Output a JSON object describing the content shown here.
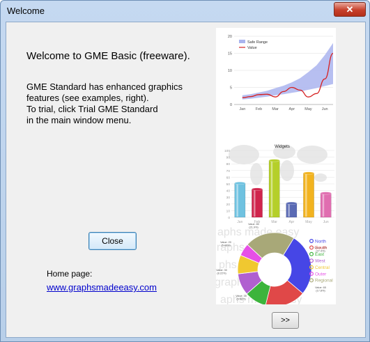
{
  "window": {
    "title": "Welcome",
    "close_glyph": "✕"
  },
  "content": {
    "heading": "Welcome to GME Basic (freeware).",
    "lines": [
      "GME Standard has enhanced graphics",
      "features (see examples, right).",
      "To trial, click Trial GME Standard",
      "in the main window menu."
    ],
    "close_button": "Close",
    "home_label": "Home page:",
    "home_link": "www.graphsmadeeasy.com",
    "next_button": ">>"
  },
  "chart_data": [
    {
      "type": "area",
      "categories": [
        "Jan",
        "Feb",
        "Mar",
        "Apr",
        "May",
        "Jun"
      ],
      "ylim": [
        0,
        20
      ],
      "yticks": [
        0,
        5,
        10,
        15,
        20
      ],
      "legend": "top-left",
      "grid": true,
      "series": [
        {
          "name": "Safe Range",
          "color": "#aab4ee",
          "x": [
            0,
            0.5,
            1,
            1.5,
            2,
            2.5,
            3,
            3.5,
            4,
            4.5,
            5,
            5.5
          ],
          "low": [
            1.5,
            1.7,
            2.0,
            2.3,
            2.7,
            3.0,
            3.4,
            3.8,
            4.3,
            4.8,
            5.4,
            6.0
          ],
          "high": [
            2.7,
            3.0,
            3.5,
            4.0,
            4.8,
            5.5,
            6.5,
            7.7,
            9.5,
            11.5,
            14.5,
            18.0
          ]
        },
        {
          "name": "Value",
          "color": "#d62020",
          "x": [
            0,
            0.5,
            1,
            1.5,
            2,
            2.5,
            3,
            3.5,
            4,
            4.5,
            5,
            5.5
          ],
          "values": [
            2.0,
            2.3,
            2.9,
            3.0,
            2.2,
            3.8,
            5.0,
            4.2,
            2.2,
            3.2,
            7.5,
            15.0
          ]
        }
      ]
    },
    {
      "type": "bar",
      "title": "Widgets",
      "categories": [
        "Jan",
        "Feb",
        "Mar",
        "Apr",
        "May",
        "Jun"
      ],
      "values": [
        51,
        42,
        85,
        21,
        66,
        36
      ],
      "ylim": [
        0,
        100
      ],
      "yticks": [
        0,
        10,
        20,
        30,
        40,
        50,
        60,
        70,
        80,
        90,
        100
      ],
      "colors": [
        "#6fc2e0",
        "#d0244c",
        "#b5cf2a",
        "#5a6ab4",
        "#f2b31f",
        "#e06eb0"
      ],
      "grid": true
    },
    {
      "type": "pie",
      "legend": "right",
      "slices": [
        {
          "name": "North",
          "value": 100,
          "color": "#4646e6"
        },
        {
          "name": "South",
          "value": 65,
          "color": "#e04848"
        },
        {
          "name": "East",
          "value": 35,
          "color": "#3cb43c"
        },
        {
          "name": "West",
          "value": 35,
          "color": "#b060d0"
        },
        {
          "name": "Central",
          "value": 30,
          "color": "#f0c830"
        },
        {
          "name": "Outer",
          "value": 20,
          "color": "#e650e6"
        },
        {
          "name": "Regional",
          "value": 80,
          "color": "#a8a878"
        }
      ],
      "labels": [
        {
          "v": "Value: 100",
          "p": "(27.4%)"
        },
        {
          "v": "Value: 65",
          "p": "(17.8%)"
        },
        {
          "v": "Value: 35",
          "p": "(9.59%)"
        },
        {
          "v": "Value: 35",
          "p": "(9.59%)"
        },
        {
          "v": "Value: 30",
          "p": "(8.22%)"
        },
        {
          "v": "Value: 20",
          "p": "(5.48%)"
        },
        {
          "v": "Value: 80",
          "p": "(21.9%)"
        }
      ]
    }
  ]
}
